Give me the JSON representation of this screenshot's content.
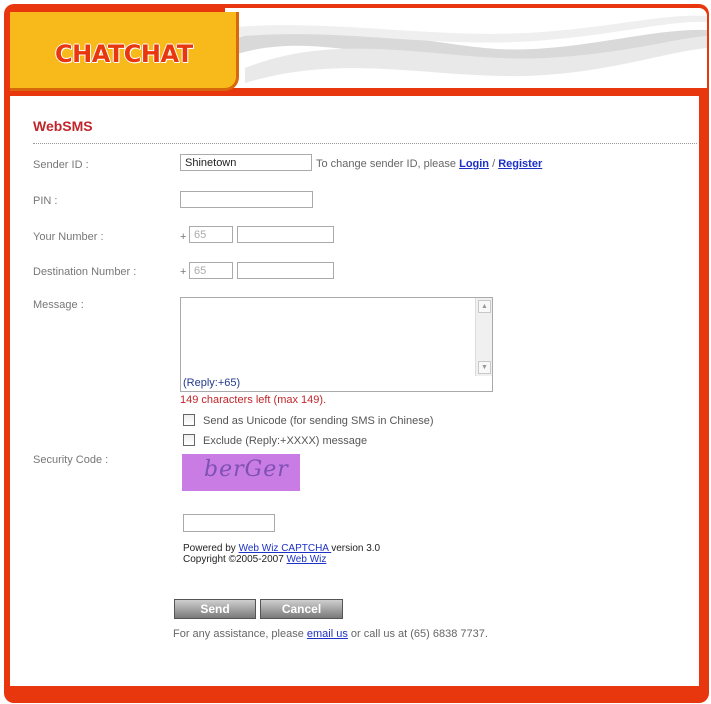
{
  "header": {
    "brand": "CHATCHAT"
  },
  "page": {
    "title": "WebSMS"
  },
  "form": {
    "sender_id": {
      "label": "Sender ID :",
      "value": "Shinetown",
      "hint_prefix": "To change sender ID, please ",
      "login_link": "Login",
      "separator": " / ",
      "register_link": "Register"
    },
    "pin": {
      "label": "PIN :",
      "value": ""
    },
    "your_number": {
      "label": "Your Number :",
      "plus": "+",
      "country_code": "65",
      "number": ""
    },
    "destination_number": {
      "label": "Destination Number :",
      "plus": "+",
      "country_code": "65",
      "number": ""
    },
    "message": {
      "label": "Message :",
      "value": "",
      "reply_suffix": "(Reply:+65)",
      "chars_left": "149 characters left (max 149)."
    },
    "options": {
      "unicode_label": "Send as Unicode (for sending SMS in Chinese)",
      "unicode_checked": false,
      "exclude_label": "Exclude (Reply:+XXXX) message",
      "exclude_checked": false
    },
    "security": {
      "label": "Security Code :",
      "captcha_text": "berGer",
      "input_value": "",
      "powered_by_prefix": "Powered by ",
      "powered_by_link": "Web Wiz CAPTCHA ",
      "powered_by_suffix": "version 3.0",
      "copyright_prefix": "Copyright ©2005-2007 ",
      "copyright_link": "Web Wiz"
    },
    "buttons": {
      "send": "Send",
      "cancel": "Cancel"
    },
    "assist": {
      "prefix": "For any assistance, please ",
      "email_link": "email us",
      "suffix": " or call us at (65) 6838 7737."
    }
  },
  "colors": {
    "frame": "#e8360e",
    "logo_bg": "#f8b91b",
    "title": "#c0262b",
    "link": "#1d31c6",
    "button": "#8a8a8a"
  }
}
